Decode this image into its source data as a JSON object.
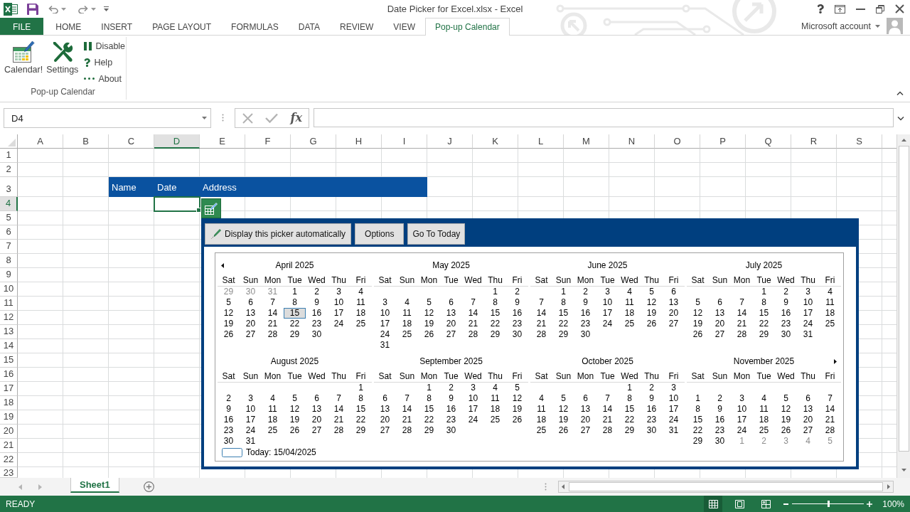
{
  "title_bar": {
    "title": "Date Picker for Excel.xlsx - Excel"
  },
  "ribbon_tabs": [
    {
      "label": "FILE",
      "kind": "file",
      "selected": false
    },
    {
      "label": "HOME",
      "kind": "tab",
      "selected": false
    },
    {
      "label": "INSERT",
      "kind": "tab",
      "selected": false
    },
    {
      "label": "PAGE LAYOUT",
      "kind": "tab",
      "selected": false
    },
    {
      "label": "FORMULAS",
      "kind": "tab",
      "selected": false
    },
    {
      "label": "DATA",
      "kind": "tab",
      "selected": false
    },
    {
      "label": "REVIEW",
      "kind": "tab",
      "selected": false
    },
    {
      "label": "VIEW",
      "kind": "tab",
      "selected": false
    },
    {
      "label": "Pop-up Calendar",
      "kind": "tab",
      "selected": true
    }
  ],
  "account": {
    "label": "Microsoft account"
  },
  "ribbon": {
    "large_buttons": [
      {
        "label": "Calendar!"
      },
      {
        "label": "Settings"
      }
    ],
    "small_buttons": [
      {
        "label": "Disable"
      },
      {
        "label": "Help"
      },
      {
        "label": "About"
      }
    ],
    "group_label": "Pop-up Calendar"
  },
  "formula_bar": {
    "name_box": "D4",
    "function_button": "fx"
  },
  "sheet": {
    "columns": [
      {
        "label": "A",
        "selected": false
      },
      {
        "label": "B",
        "selected": false
      },
      {
        "label": "C",
        "selected": false
      },
      {
        "label": "D",
        "selected": true
      },
      {
        "label": "E",
        "selected": false
      },
      {
        "label": "F",
        "selected": false
      },
      {
        "label": "G",
        "selected": false
      },
      {
        "label": "H",
        "selected": false
      },
      {
        "label": "I",
        "selected": false
      },
      {
        "label": "J",
        "selected": false
      },
      {
        "label": "K",
        "selected": false
      },
      {
        "label": "L",
        "selected": false
      },
      {
        "label": "M",
        "selected": false
      },
      {
        "label": "N",
        "selected": false
      },
      {
        "label": "O",
        "selected": false
      },
      {
        "label": "P",
        "selected": false
      },
      {
        "label": "Q",
        "selected": false
      },
      {
        "label": "R",
        "selected": false
      },
      {
        "label": "S",
        "selected": false
      }
    ],
    "rows": [
      {
        "label": "1",
        "selected": false
      },
      {
        "label": "2",
        "selected": false
      },
      {
        "label": "3",
        "selected": false
      },
      {
        "label": "4",
        "selected": true
      },
      {
        "label": "5",
        "selected": false
      },
      {
        "label": "6",
        "selected": false
      },
      {
        "label": "7",
        "selected": false
      },
      {
        "label": "8",
        "selected": false
      },
      {
        "label": "9",
        "selected": false
      },
      {
        "label": "10",
        "selected": false
      },
      {
        "label": "11",
        "selected": false
      },
      {
        "label": "12",
        "selected": false
      },
      {
        "label": "13",
        "selected": false
      },
      {
        "label": "14",
        "selected": false
      },
      {
        "label": "15",
        "selected": false
      },
      {
        "label": "16",
        "selected": false
      },
      {
        "label": "17",
        "selected": false
      },
      {
        "label": "18",
        "selected": false
      },
      {
        "label": "19",
        "selected": false
      },
      {
        "label": "20",
        "selected": false
      },
      {
        "label": "21",
        "selected": false
      },
      {
        "label": "22",
        "selected": false
      },
      {
        "label": "23",
        "selected": false
      }
    ],
    "table_header": [
      "Name",
      "Date",
      "Address"
    ]
  },
  "date_picker": {
    "buttons": [
      "Display this picker automatically",
      "Options",
      "Go To Today"
    ],
    "months": [
      {
        "title": "April 2025",
        "weekdays": [
          "Sat",
          "Sun",
          "Mon",
          "Tue",
          "Wed",
          "Thu",
          "Fri"
        ],
        "weeks": [
          [
            {
              "day": "29",
              "muted": true,
              "today": false
            },
            {
              "day": "30",
              "muted": true,
              "today": false
            },
            {
              "day": "31",
              "muted": true,
              "today": false
            },
            {
              "day": "1",
              "muted": false,
              "today": false
            },
            {
              "day": "2",
              "muted": false,
              "today": false
            },
            {
              "day": "3",
              "muted": false,
              "today": false
            },
            {
              "day": "4",
              "muted": false,
              "today": false
            }
          ],
          [
            {
              "day": "5",
              "muted": false,
              "today": false
            },
            {
              "day": "6",
              "muted": false,
              "today": false
            },
            {
              "day": "7",
              "muted": false,
              "today": false
            },
            {
              "day": "8",
              "muted": false,
              "today": false
            },
            {
              "day": "9",
              "muted": false,
              "today": false
            },
            {
              "day": "10",
              "muted": false,
              "today": false
            },
            {
              "day": "11",
              "muted": false,
              "today": false
            }
          ],
          [
            {
              "day": "12",
              "muted": false,
              "today": false
            },
            {
              "day": "13",
              "muted": false,
              "today": false
            },
            {
              "day": "14",
              "muted": false,
              "today": false
            },
            {
              "day": "15",
              "muted": false,
              "today": true
            },
            {
              "day": "16",
              "muted": false,
              "today": false
            },
            {
              "day": "17",
              "muted": false,
              "today": false
            },
            {
              "day": "18",
              "muted": false,
              "today": false
            }
          ],
          [
            {
              "day": "19",
              "muted": false,
              "today": false
            },
            {
              "day": "20",
              "muted": false,
              "today": false
            },
            {
              "day": "21",
              "muted": false,
              "today": false
            },
            {
              "day": "22",
              "muted": false,
              "today": false
            },
            {
              "day": "23",
              "muted": false,
              "today": false
            },
            {
              "day": "24",
              "muted": false,
              "today": false
            },
            {
              "day": "25",
              "muted": false,
              "today": false
            }
          ],
          [
            {
              "day": "26",
              "muted": false,
              "today": false
            },
            {
              "day": "27",
              "muted": false,
              "today": false
            },
            {
              "day": "28",
              "muted": false,
              "today": false
            },
            {
              "day": "29",
              "muted": false,
              "today": false
            },
            {
              "day": "30",
              "muted": false,
              "today": false
            }
          ]
        ]
      },
      {
        "title": "May 2025",
        "weekdays": [
          "Sat",
          "Sun",
          "Mon",
          "Tue",
          "Wed",
          "Thu",
          "Fri"
        ],
        "weeks": [
          [
            {
              "day": "1",
              "muted": false,
              "today": false
            },
            {
              "day": "2",
              "muted": false,
              "today": false
            }
          ],
          [
            {
              "day": "3",
              "muted": false,
              "today": false
            },
            {
              "day": "4",
              "muted": false,
              "today": false
            },
            {
              "day": "5",
              "muted": false,
              "today": false
            },
            {
              "day": "6",
              "muted": false,
              "today": false
            },
            {
              "day": "7",
              "muted": false,
              "today": false
            },
            {
              "day": "8",
              "muted": false,
              "today": false
            },
            {
              "day": "9",
              "muted": false,
              "today": false
            }
          ],
          [
            {
              "day": "10",
              "muted": false,
              "today": false
            },
            {
              "day": "11",
              "muted": false,
              "today": false
            },
            {
              "day": "12",
              "muted": false,
              "today": false
            },
            {
              "day": "13",
              "muted": false,
              "today": false
            },
            {
              "day": "14",
              "muted": false,
              "today": false
            },
            {
              "day": "15",
              "muted": false,
              "today": false
            },
            {
              "day": "16",
              "muted": false,
              "today": false
            }
          ],
          [
            {
              "day": "17",
              "muted": false,
              "today": false
            },
            {
              "day": "18",
              "muted": false,
              "today": false
            },
            {
              "day": "19",
              "muted": false,
              "today": false
            },
            {
              "day": "20",
              "muted": false,
              "today": false
            },
            {
              "day": "21",
              "muted": false,
              "today": false
            },
            {
              "day": "22",
              "muted": false,
              "today": false
            },
            {
              "day": "23",
              "muted": false,
              "today": false
            }
          ],
          [
            {
              "day": "24",
              "muted": false,
              "today": false
            },
            {
              "day": "25",
              "muted": false,
              "today": false
            },
            {
              "day": "26",
              "muted": false,
              "today": false
            },
            {
              "day": "27",
              "muted": false,
              "today": false
            },
            {
              "day": "28",
              "muted": false,
              "today": false
            },
            {
              "day": "29",
              "muted": false,
              "today": false
            },
            {
              "day": "30",
              "muted": false,
              "today": false
            }
          ],
          [
            {
              "day": "31",
              "muted": false,
              "today": false
            }
          ]
        ]
      },
      {
        "title": "June 2025",
        "weekdays": [
          "Sat",
          "Sun",
          "Mon",
          "Tue",
          "Wed",
          "Thu",
          "Fri"
        ],
        "weeks": [
          [
            {
              "day": "1",
              "muted": false,
              "today": false
            },
            {
              "day": "2",
              "muted": false,
              "today": false
            },
            {
              "day": "3",
              "muted": false,
              "today": false
            },
            {
              "day": "4",
              "muted": false,
              "today": false
            },
            {
              "day": "5",
              "muted": false,
              "today": false
            },
            {
              "day": "6",
              "muted": false,
              "today": false
            }
          ],
          [
            {
              "day": "7",
              "muted": false,
              "today": false
            },
            {
              "day": "8",
              "muted": false,
              "today": false
            },
            {
              "day": "9",
              "muted": false,
              "today": false
            },
            {
              "day": "10",
              "muted": false,
              "today": false
            },
            {
              "day": "11",
              "muted": false,
              "today": false
            },
            {
              "day": "12",
              "muted": false,
              "today": false
            },
            {
              "day": "13",
              "muted": false,
              "today": false
            }
          ],
          [
            {
              "day": "14",
              "muted": false,
              "today": false
            },
            {
              "day": "15",
              "muted": false,
              "today": false
            },
            {
              "day": "16",
              "muted": false,
              "today": false
            },
            {
              "day": "17",
              "muted": false,
              "today": false
            },
            {
              "day": "18",
              "muted": false,
              "today": false
            },
            {
              "day": "19",
              "muted": false,
              "today": false
            },
            {
              "day": "20",
              "muted": false,
              "today": false
            }
          ],
          [
            {
              "day": "21",
              "muted": false,
              "today": false
            },
            {
              "day": "22",
              "muted": false,
              "today": false
            },
            {
              "day": "23",
              "muted": false,
              "today": false
            },
            {
              "day": "24",
              "muted": false,
              "today": false
            },
            {
              "day": "25",
              "muted": false,
              "today": false
            },
            {
              "day": "26",
              "muted": false,
              "today": false
            },
            {
              "day": "27",
              "muted": false,
              "today": false
            }
          ],
          [
            {
              "day": "28",
              "muted": false,
              "today": false
            },
            {
              "day": "29",
              "muted": false,
              "today": false
            },
            {
              "day": "30",
              "muted": false,
              "today": false
            }
          ]
        ]
      },
      {
        "title": "July 2025",
        "weekdays": [
          "Sat",
          "Sun",
          "Mon",
          "Tue",
          "Wed",
          "Thu",
          "Fri"
        ],
        "weeks": [
          [
            {
              "day": "1",
              "muted": false,
              "today": false
            },
            {
              "day": "2",
              "muted": false,
              "today": false
            },
            {
              "day": "3",
              "muted": false,
              "today": false
            },
            {
              "day": "4",
              "muted": false,
              "today": false
            }
          ],
          [
            {
              "day": "5",
              "muted": false,
              "today": false
            },
            {
              "day": "6",
              "muted": false,
              "today": false
            },
            {
              "day": "7",
              "muted": false,
              "today": false
            },
            {
              "day": "8",
              "muted": false,
              "today": false
            },
            {
              "day": "9",
              "muted": false,
              "today": false
            },
            {
              "day": "10",
              "muted": false,
              "today": false
            },
            {
              "day": "11",
              "muted": false,
              "today": false
            }
          ],
          [
            {
              "day": "12",
              "muted": false,
              "today": false
            },
            {
              "day": "13",
              "muted": false,
              "today": false
            },
            {
              "day": "14",
              "muted": false,
              "today": false
            },
            {
              "day": "15",
              "muted": false,
              "today": false
            },
            {
              "day": "16",
              "muted": false,
              "today": false
            },
            {
              "day": "17",
              "muted": false,
              "today": false
            },
            {
              "day": "18",
              "muted": false,
              "today": false
            }
          ],
          [
            {
              "day": "19",
              "muted": false,
              "today": false
            },
            {
              "day": "20",
              "muted": false,
              "today": false
            },
            {
              "day": "21",
              "muted": false,
              "today": false
            },
            {
              "day": "22",
              "muted": false,
              "today": false
            },
            {
              "day": "23",
              "muted": false,
              "today": false
            },
            {
              "day": "24",
              "muted": false,
              "today": false
            },
            {
              "day": "25",
              "muted": false,
              "today": false
            }
          ],
          [
            {
              "day": "26",
              "muted": false,
              "today": false
            },
            {
              "day": "27",
              "muted": false,
              "today": false
            },
            {
              "day": "28",
              "muted": false,
              "today": false
            },
            {
              "day": "29",
              "muted": false,
              "today": false
            },
            {
              "day": "30",
              "muted": false,
              "today": false
            },
            {
              "day": "31",
              "muted": false,
              "today": false
            }
          ]
        ]
      },
      {
        "title": "August 2025",
        "weekdays": [
          "Sat",
          "Sun",
          "Mon",
          "Tue",
          "Wed",
          "Thu",
          "Fri"
        ],
        "weeks": [
          [
            {
              "day": "1",
              "muted": false,
              "today": false
            }
          ],
          [
            {
              "day": "2",
              "muted": false,
              "today": false
            },
            {
              "day": "3",
              "muted": false,
              "today": false
            },
            {
              "day": "4",
              "muted": false,
              "today": false
            },
            {
              "day": "5",
              "muted": false,
              "today": false
            },
            {
              "day": "6",
              "muted": false,
              "today": false
            },
            {
              "day": "7",
              "muted": false,
              "today": false
            },
            {
              "day": "8",
              "muted": false,
              "today": false
            }
          ],
          [
            {
              "day": "9",
              "muted": false,
              "today": false
            },
            {
              "day": "10",
              "muted": false,
              "today": false
            },
            {
              "day": "11",
              "muted": false,
              "today": false
            },
            {
              "day": "12",
              "muted": false,
              "today": false
            },
            {
              "day": "13",
              "muted": false,
              "today": false
            },
            {
              "day": "14",
              "muted": false,
              "today": false
            },
            {
              "day": "15",
              "muted": false,
              "today": false
            }
          ],
          [
            {
              "day": "16",
              "muted": false,
              "today": false
            },
            {
              "day": "17",
              "muted": false,
              "today": false
            },
            {
              "day": "18",
              "muted": false,
              "today": false
            },
            {
              "day": "19",
              "muted": false,
              "today": false
            },
            {
              "day": "20",
              "muted": false,
              "today": false
            },
            {
              "day": "21",
              "muted": false,
              "today": false
            },
            {
              "day": "22",
              "muted": false,
              "today": false
            }
          ],
          [
            {
              "day": "23",
              "muted": false,
              "today": false
            },
            {
              "day": "24",
              "muted": false,
              "today": false
            },
            {
              "day": "25",
              "muted": false,
              "today": false
            },
            {
              "day": "26",
              "muted": false,
              "today": false
            },
            {
              "day": "27",
              "muted": false,
              "today": false
            },
            {
              "day": "28",
              "muted": false,
              "today": false
            },
            {
              "day": "29",
              "muted": false,
              "today": false
            }
          ],
          [
            {
              "day": "30",
              "muted": false,
              "today": false
            },
            {
              "day": "31",
              "muted": false,
              "today": false
            }
          ]
        ]
      },
      {
        "title": "September 2025",
        "weekdays": [
          "Sat",
          "Sun",
          "Mon",
          "Tue",
          "Wed",
          "Thu",
          "Fri"
        ],
        "weeks": [
          [
            {
              "day": "1",
              "muted": false,
              "today": false
            },
            {
              "day": "2",
              "muted": false,
              "today": false
            },
            {
              "day": "3",
              "muted": false,
              "today": false
            },
            {
              "day": "4",
              "muted": false,
              "today": false
            },
            {
              "day": "5",
              "muted": false,
              "today": false
            }
          ],
          [
            {
              "day": "6",
              "muted": false,
              "today": false
            },
            {
              "day": "7",
              "muted": false,
              "today": false
            },
            {
              "day": "8",
              "muted": false,
              "today": false
            },
            {
              "day": "9",
              "muted": false,
              "today": false
            },
            {
              "day": "10",
              "muted": false,
              "today": false
            },
            {
              "day": "11",
              "muted": false,
              "today": false
            },
            {
              "day": "12",
              "muted": false,
              "today": false
            }
          ],
          [
            {
              "day": "13",
              "muted": false,
              "today": false
            },
            {
              "day": "14",
              "muted": false,
              "today": false
            },
            {
              "day": "15",
              "muted": false,
              "today": false
            },
            {
              "day": "16",
              "muted": false,
              "today": false
            },
            {
              "day": "17",
              "muted": false,
              "today": false
            },
            {
              "day": "18",
              "muted": false,
              "today": false
            },
            {
              "day": "19",
              "muted": false,
              "today": false
            }
          ],
          [
            {
              "day": "20",
              "muted": false,
              "today": false
            },
            {
              "day": "21",
              "muted": false,
              "today": false
            },
            {
              "day": "22",
              "muted": false,
              "today": false
            },
            {
              "day": "23",
              "muted": false,
              "today": false
            },
            {
              "day": "24",
              "muted": false,
              "today": false
            },
            {
              "day": "25",
              "muted": false,
              "today": false
            },
            {
              "day": "26",
              "muted": false,
              "today": false
            }
          ],
          [
            {
              "day": "27",
              "muted": false,
              "today": false
            },
            {
              "day": "28",
              "muted": false,
              "today": false
            },
            {
              "day": "29",
              "muted": false,
              "today": false
            },
            {
              "day": "30",
              "muted": false,
              "today": false
            }
          ]
        ]
      },
      {
        "title": "October 2025",
        "weekdays": [
          "Sat",
          "Sun",
          "Mon",
          "Tue",
          "Wed",
          "Thu",
          "Fri"
        ],
        "weeks": [
          [
            {
              "day": "1",
              "muted": false,
              "today": false
            },
            {
              "day": "2",
              "muted": false,
              "today": false
            },
            {
              "day": "3",
              "muted": false,
              "today": false
            }
          ],
          [
            {
              "day": "4",
              "muted": false,
              "today": false
            },
            {
              "day": "5",
              "muted": false,
              "today": false
            },
            {
              "day": "6",
              "muted": false,
              "today": false
            },
            {
              "day": "7",
              "muted": false,
              "today": false
            },
            {
              "day": "8",
              "muted": false,
              "today": false
            },
            {
              "day": "9",
              "muted": false,
              "today": false
            },
            {
              "day": "10",
              "muted": false,
              "today": false
            }
          ],
          [
            {
              "day": "11",
              "muted": false,
              "today": false
            },
            {
              "day": "12",
              "muted": false,
              "today": false
            },
            {
              "day": "13",
              "muted": false,
              "today": false
            },
            {
              "day": "14",
              "muted": false,
              "today": false
            },
            {
              "day": "15",
              "muted": false,
              "today": false
            },
            {
              "day": "16",
              "muted": false,
              "today": false
            },
            {
              "day": "17",
              "muted": false,
              "today": false
            }
          ],
          [
            {
              "day": "18",
              "muted": false,
              "today": false
            },
            {
              "day": "19",
              "muted": false,
              "today": false
            },
            {
              "day": "20",
              "muted": false,
              "today": false
            },
            {
              "day": "21",
              "muted": false,
              "today": false
            },
            {
              "day": "22",
              "muted": false,
              "today": false
            },
            {
              "day": "23",
              "muted": false,
              "today": false
            },
            {
              "day": "24",
              "muted": false,
              "today": false
            }
          ],
          [
            {
              "day": "25",
              "muted": false,
              "today": false
            },
            {
              "day": "26",
              "muted": false,
              "today": false
            },
            {
              "day": "27",
              "muted": false,
              "today": false
            },
            {
              "day": "28",
              "muted": false,
              "today": false
            },
            {
              "day": "29",
              "muted": false,
              "today": false
            },
            {
              "day": "30",
              "muted": false,
              "today": false
            },
            {
              "day": "31",
              "muted": false,
              "today": false
            }
          ]
        ]
      },
      {
        "title": "November 2025",
        "weekdays": [
          "Sat",
          "Sun",
          "Mon",
          "Tue",
          "Wed",
          "Thu",
          "Fri"
        ],
        "weeks": [
          [
            {
              "day": "1",
              "muted": false,
              "today": false
            },
            {
              "day": "2",
              "muted": false,
              "today": false
            },
            {
              "day": "3",
              "muted": false,
              "today": false
            },
            {
              "day": "4",
              "muted": false,
              "today": false
            },
            {
              "day": "5",
              "muted": false,
              "today": false
            },
            {
              "day": "6",
              "muted": false,
              "today": false
            },
            {
              "day": "7",
              "muted": false,
              "today": false
            }
          ],
          [
            {
              "day": "8",
              "muted": false,
              "today": false
            },
            {
              "day": "9",
              "muted": false,
              "today": false
            },
            {
              "day": "10",
              "muted": false,
              "today": false
            },
            {
              "day": "11",
              "muted": false,
              "today": false
            },
            {
              "day": "12",
              "muted": false,
              "today": false
            },
            {
              "day": "13",
              "muted": false,
              "today": false
            },
            {
              "day": "14",
              "muted": false,
              "today": false
            }
          ],
          [
            {
              "day": "15",
              "muted": false,
              "today": false
            },
            {
              "day": "16",
              "muted": false,
              "today": false
            },
            {
              "day": "17",
              "muted": false,
              "today": false
            },
            {
              "day": "18",
              "muted": false,
              "today": false
            },
            {
              "day": "19",
              "muted": false,
              "today": false
            },
            {
              "day": "20",
              "muted": false,
              "today": false
            },
            {
              "day": "21",
              "muted": false,
              "today": false
            }
          ],
          [
            {
              "day": "22",
              "muted": false,
              "today": false
            },
            {
              "day": "23",
              "muted": false,
              "today": false
            },
            {
              "day": "24",
              "muted": false,
              "today": false
            },
            {
              "day": "25",
              "muted": false,
              "today": false
            },
            {
              "day": "26",
              "muted": false,
              "today": false
            },
            {
              "day": "27",
              "muted": false,
              "today": false
            },
            {
              "day": "28",
              "muted": false,
              "today": false
            }
          ],
          [
            {
              "day": "29",
              "muted": false,
              "today": false
            },
            {
              "day": "30",
              "muted": false,
              "today": false
            },
            {
              "day": "1",
              "muted": true,
              "today": false
            },
            {
              "day": "2",
              "muted": true,
              "today": false
            },
            {
              "day": "3",
              "muted": true,
              "today": false
            },
            {
              "day": "4",
              "muted": true,
              "today": false
            },
            {
              "day": "5",
              "muted": true,
              "today": false
            }
          ]
        ]
      }
    ],
    "today_label": "Today: 15/04/2025"
  },
  "sheet_tabs": [
    {
      "label": "Sheet1",
      "selected": true
    }
  ],
  "status_bar": {
    "status": "READY",
    "views": [
      {
        "selected": true
      },
      {
        "selected": false
      },
      {
        "selected": false
      }
    ],
    "zoom": {
      "level": 0.5,
      "reading": "100%"
    }
  }
}
